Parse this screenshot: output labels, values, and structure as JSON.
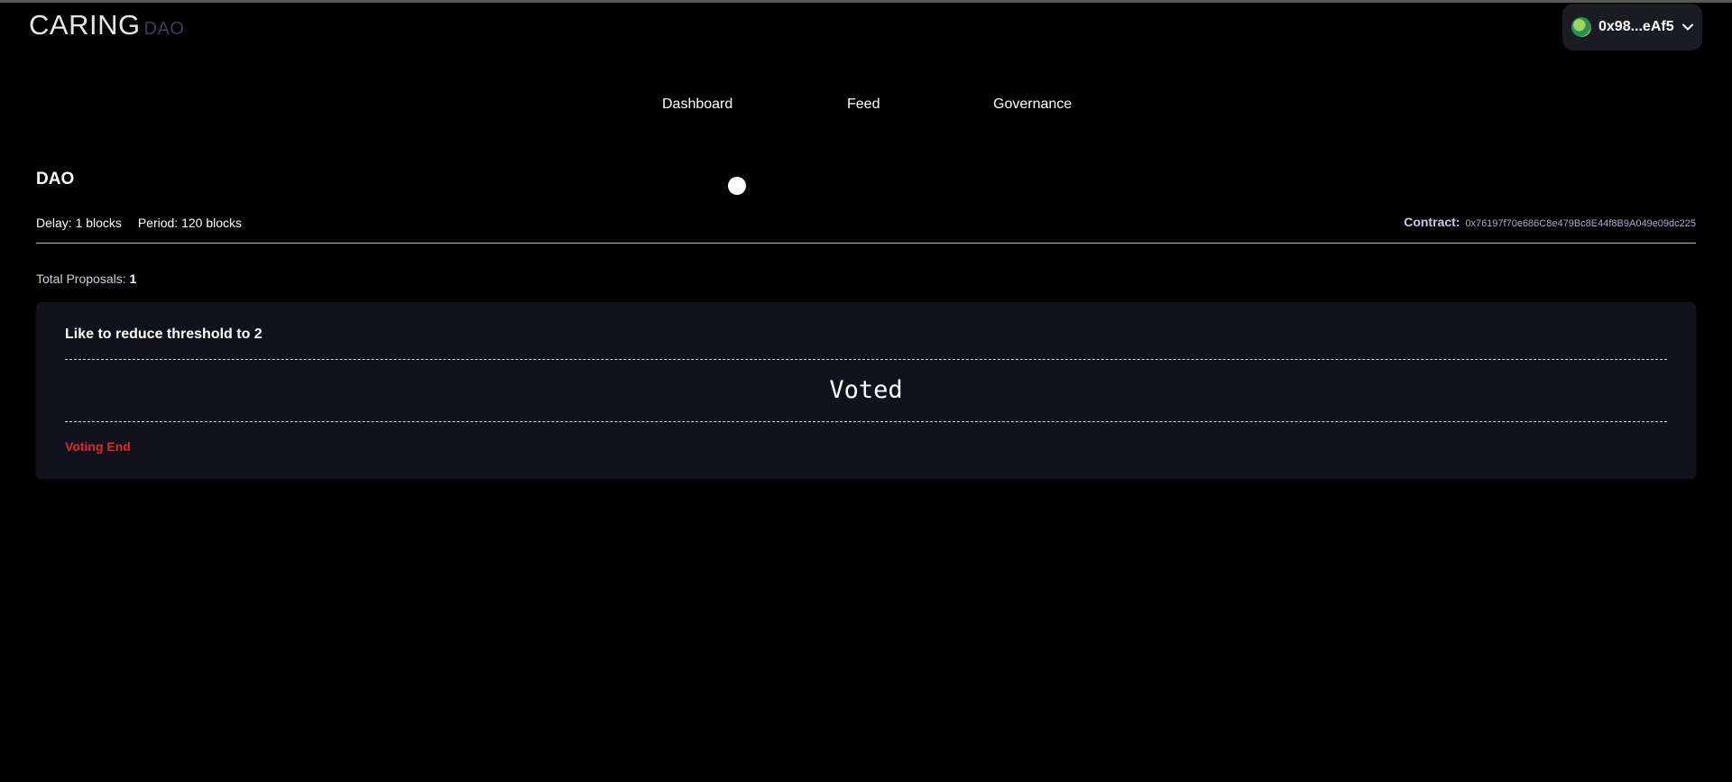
{
  "header": {
    "logo_main": "CARING",
    "logo_sub": "DAO",
    "wallet_address": "0x98...eAf5",
    "icons": {
      "avatar": "wallet-avatar",
      "chevron": "chevron-down-icon"
    }
  },
  "nav": {
    "items": [
      {
        "label": "Dashboard"
      },
      {
        "label": "Feed"
      },
      {
        "label": "Governance"
      }
    ]
  },
  "dao": {
    "title": "DAO",
    "delay_label": "Delay: 1 blocks",
    "period_label": "Period: 120 blocks",
    "contract_label": "Contract:",
    "contract_value": "0x76197f70e686C8e479Bc8E44f8B9A049e09dc225",
    "total_label": "Total Proposals:",
    "total_value": "1"
  },
  "proposals": [
    {
      "title": "Like to reduce threshold to 2",
      "vote_status": "Voted",
      "status_text": "Voting End",
      "status_color": "#e0262b"
    }
  ],
  "colors": {
    "background": "#000000",
    "card": "#12121d",
    "wallet_bg": "#1b1c22"
  }
}
